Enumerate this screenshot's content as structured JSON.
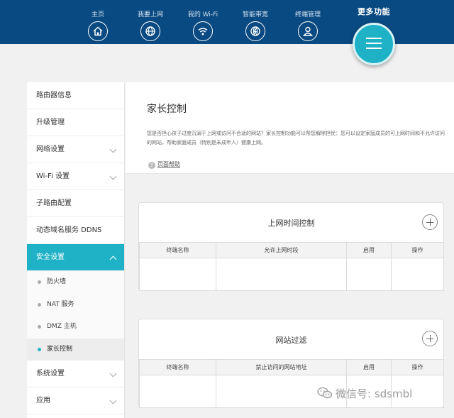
{
  "nav": [
    {
      "label": "主页",
      "icon": "home-icon"
    },
    {
      "label": "我要上网",
      "icon": "globe-icon"
    },
    {
      "label": "我的 Wi-Fi",
      "icon": "wifi-icon"
    },
    {
      "label": "智能带宽",
      "icon": "bandwidth-icon"
    },
    {
      "label": "终端管理",
      "icon": "user-icon"
    }
  ],
  "more": {
    "label": "更多功能",
    "icon": "menu-icon"
  },
  "sidebar": {
    "items": [
      {
        "label": "路由器信息"
      },
      {
        "label": "升级管理"
      },
      {
        "label": "网络设置"
      },
      {
        "label": "Wi-Fi 设置"
      },
      {
        "label": "子路由配置"
      },
      {
        "label": "动态域名服务 DDNS"
      },
      {
        "label": "安全设置"
      },
      {
        "label": "系统设置"
      },
      {
        "label": "应用"
      }
    ],
    "sub_items": [
      {
        "label": "防火墙"
      },
      {
        "label": "NAT 服务"
      },
      {
        "label": "DMZ 主机"
      },
      {
        "label": "家长控制"
      }
    ]
  },
  "main": {
    "title": "家长控制",
    "desc": "您是否担心孩子过度沉溺于上网或访问不合适的网站？家长控制功能可以帮您解除担忧：您可以设定家庭成员的可上网时间和不允许访问的网站，帮助家庭成员（特别是未成年人）健康上网。",
    "help": "页面帮助"
  },
  "cards": [
    {
      "title": "上网时间控制",
      "columns": [
        "终端名称",
        "允许上网时段",
        "启用",
        "操作"
      ]
    },
    {
      "title": "网站过滤",
      "columns": [
        "终端名称",
        "禁止访问的网站地址",
        "启用",
        "操作"
      ]
    }
  ],
  "watermark": "微信号: sdsmbl",
  "colors": {
    "header": "#0a4a82",
    "accent": "#1fb2c6"
  }
}
